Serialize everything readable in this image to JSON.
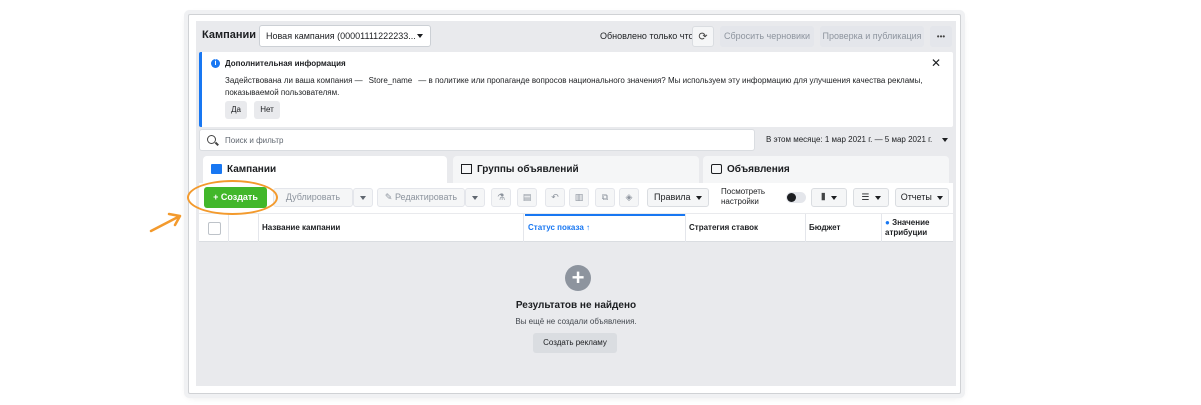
{
  "header": {
    "title": "Кампании",
    "campaign_select": "Новая кампания (00001111222233...",
    "updated": "Обновлено только что",
    "reset_drafts": "Сбросить черновики",
    "review_publish": "Проверка и публикация",
    "more": "•••"
  },
  "info": {
    "heading": "Дополнительная информация",
    "text_1": "Задействована ли ваша компания —",
    "store_name": "Store_name",
    "text_2": "— в политике или пропаганде вопросов национального значения? Мы используем эту информацию для улучшения качества рекламы, показываемой пользователям.",
    "yes": "Да",
    "no": "Нет"
  },
  "search": {
    "placeholder": "Поиск и фильтр",
    "date_range": "В этом месяце: 1 мар 2021 г. — 5 мар 2021 г."
  },
  "tabs": [
    {
      "label": "Кампании"
    },
    {
      "label": "Группы объявлений"
    },
    {
      "label": "Объявления"
    }
  ],
  "toolbar": {
    "create": "+ Создать",
    "duplicate": "Дублировать",
    "edit": "Редактировать",
    "rules": "Правила",
    "view_settings": "Посмотреть настройки",
    "reports": "Отчеты"
  },
  "table": {
    "columns": [
      "Название кампании",
      "Статус показа ↑",
      "Стратегия ставок",
      "Бюджет",
      "Значение атрибуции"
    ]
  },
  "empty": {
    "heading": "Результатов не найдено",
    "subtext": "Вы ещё не создали объявления.",
    "button": "Создать рекламу"
  },
  "colors": {
    "accent": "#1877f2",
    "create": "#42b72a",
    "annotation": "#f39a2d"
  }
}
